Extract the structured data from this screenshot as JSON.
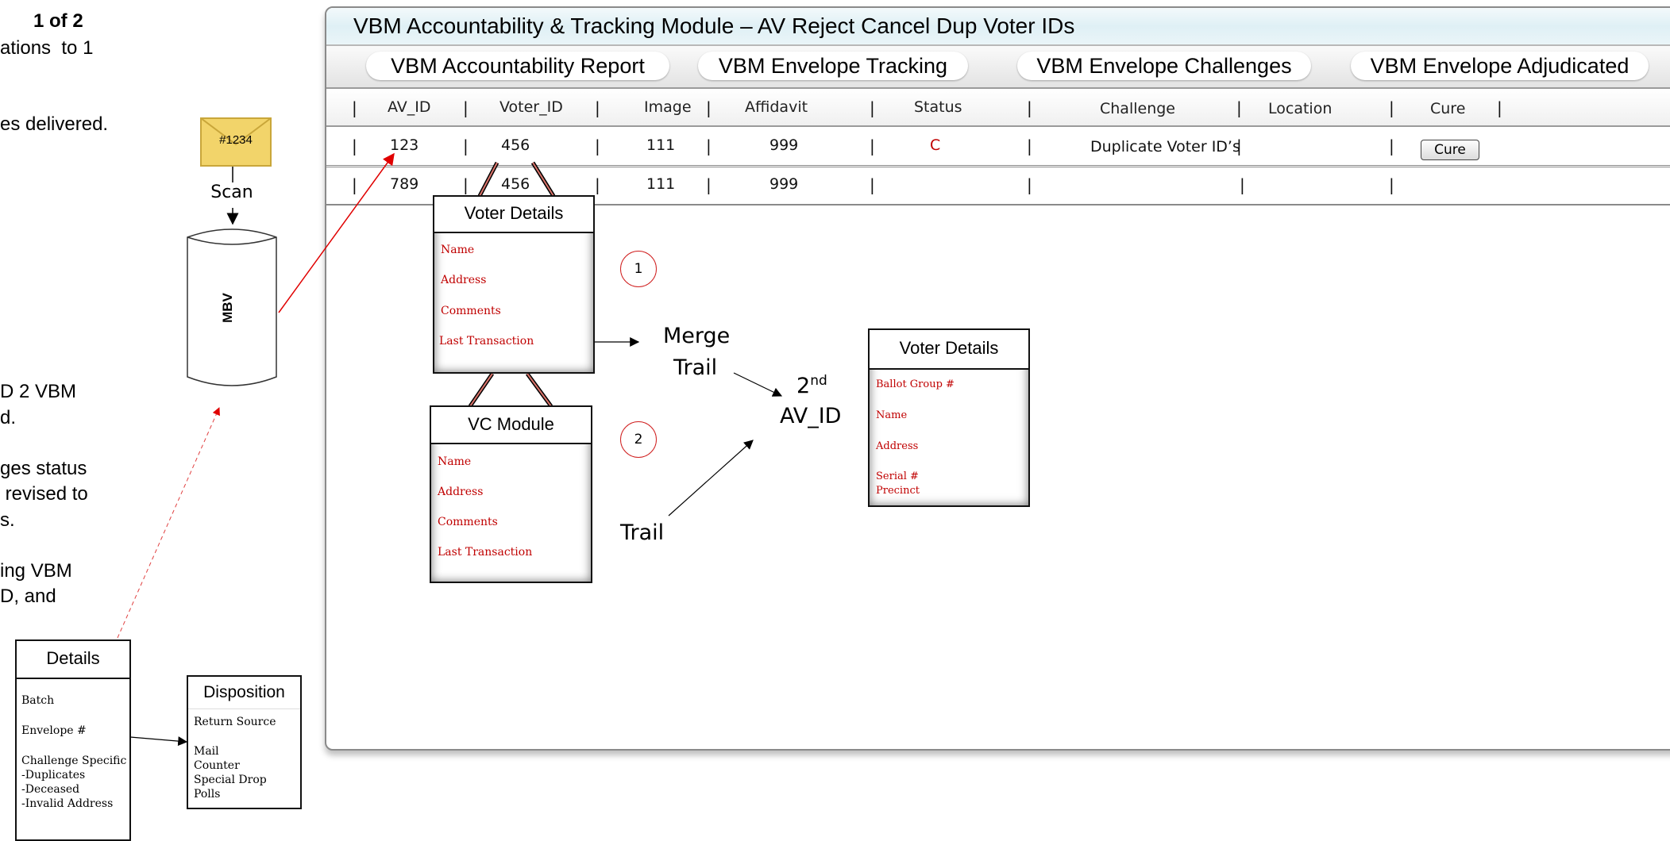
{
  "left_text": {
    "page": "1 of 2",
    "l1": "ations  to 1",
    "l2": "es delivered.",
    "l3": "D 2 VBM",
    "l4": "d.",
    "l5": "ges status",
    "l6": " revised to",
    "l7": "s.",
    "l8": "ing VBM",
    "l9": "D, and"
  },
  "envelope": {
    "label": "#1234"
  },
  "scan_label": "Scan",
  "mbv_label": "MBV",
  "window": {
    "title": "VBM Accountability & Tracking Module – AV Reject Cancel Dup Voter IDs",
    "tabs": [
      "VBM Accountability Report",
      "VBM Envelope Tracking",
      "VBM Envelope Challenges",
      "VBM Envelope Adjudicated"
    ]
  },
  "table": {
    "headers": [
      "AV_ID",
      "Voter_ID",
      "Image",
      "Affidavit",
      "Status",
      "Challenge",
      "Location",
      "Cure"
    ],
    "rows": [
      {
        "av_id": "123",
        "voter_id": "456",
        "image": "111",
        "affidavit": "999",
        "status": "C",
        "challenge": "Duplicate Voter ID’s",
        "location": "",
        "cure_button": "Cure"
      },
      {
        "av_id": "789",
        "voter_id": "456",
        "image": "111",
        "affidavit": "999",
        "status": "",
        "challenge": "",
        "location": "",
        "cure_button": ""
      }
    ]
  },
  "voter_details_1": {
    "title": "Voter Details",
    "fields": [
      "Name",
      "Address",
      "Comments",
      "Last Transaction"
    ]
  },
  "vc_module": {
    "title": "VC Module",
    "fields": [
      "Name",
      "Address",
      "Comments",
      "Last Transaction"
    ]
  },
  "voter_details_2": {
    "title": "Voter Details",
    "fields": [
      "Ballot Group #",
      "Name",
      "Address",
      "Serial #\nPrecinct"
    ]
  },
  "circles": [
    "1",
    "2"
  ],
  "flow": {
    "merge": "Merge",
    "merge_trail": "Trail",
    "second": "2",
    "second_sup": "nd",
    "av_id": "AV_ID",
    "trail": "Trail"
  },
  "details_box": {
    "title": "Details",
    "fields": [
      "Batch",
      "Envelope #",
      "Challenge Specific\n-Duplicates\n-Deceased\n-Invalid Address"
    ]
  },
  "disposition_box": {
    "title": "Disposition",
    "fields": [
      "Return Source",
      "Mail\nCounter\nSpecial Drop\nPolls"
    ]
  },
  "colors": {
    "accent_red": "#c00000",
    "titlebar": "#dff0f5",
    "envelope": "#f2d46a"
  }
}
